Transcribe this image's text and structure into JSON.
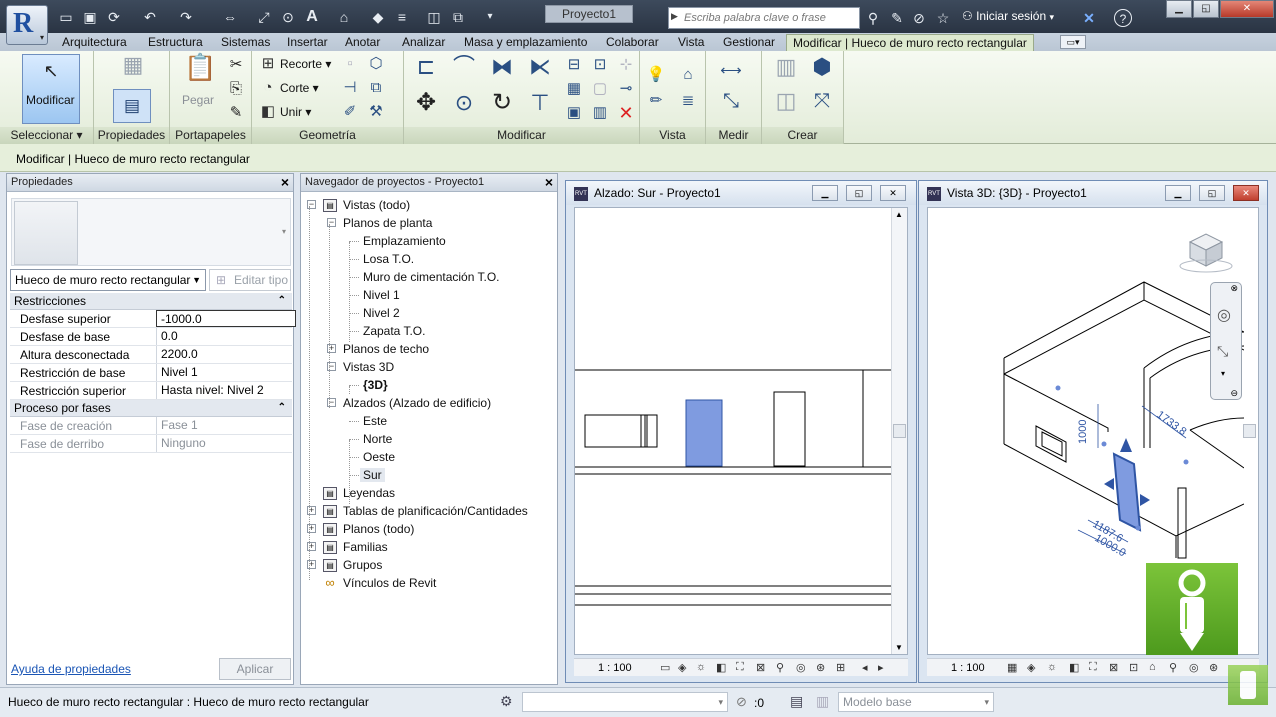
{
  "titlebar": {
    "doc_title": "Proyecto1",
    "search_placeholder": "Escriba palabra clave o frase",
    "signin_label": "Iniciar sesión",
    "help_label": "?",
    "text_tool": "A"
  },
  "tabs": [
    "Arquitectura",
    "Estructura",
    "Sistemas",
    "Insertar",
    "Anotar",
    "Analizar",
    "Masa y emplazamiento",
    "Colaborar",
    "Vista",
    "Gestionar",
    "Modificar | Hueco de muro recto rectangular"
  ],
  "ribbon": {
    "modify_label": "Modificar",
    "paste_label": "Pegar",
    "cut_menu": "Recorte",
    "section_menu": "Corte",
    "join_menu": "Unir",
    "panels": {
      "select": "Seleccionar",
      "properties": "Propiedades",
      "clipboard": "Portapapeles",
      "geometry": "Geometría",
      "modify": "Modificar",
      "view": "Vista",
      "measure": "Medir",
      "create": "Crear"
    }
  },
  "context_bar": "Modificar | Hueco de muro recto rectangular",
  "properties": {
    "title": "Propiedades",
    "type_selector": "Hueco de muro recto rectangular",
    "edit_type": "Editar tipo",
    "sections": [
      {
        "name": "Restricciones",
        "rows": [
          {
            "k": "Desfase superior",
            "v": "-1000.0"
          },
          {
            "k": "Desfase de base",
            "v": "0.0"
          },
          {
            "k": "Altura desconectada",
            "v": "2200.0"
          },
          {
            "k": "Restricción de base",
            "v": "Nivel 1"
          },
          {
            "k": "Restricción superior",
            "v": "Hasta nivel: Nivel 2"
          }
        ]
      },
      {
        "name": "Proceso por fases",
        "rows": [
          {
            "k": "Fase de creación",
            "v": "Fase 1"
          },
          {
            "k": "Fase de derribo",
            "v": "Ninguno"
          }
        ]
      }
    ],
    "help_link": "Ayuda de propiedades",
    "apply": "Aplicar"
  },
  "browser": {
    "title": "Navegador de proyectos - Proyecto1",
    "nodes": [
      {
        "label": "Vistas (todo)",
        "level": 0,
        "exp": "−"
      },
      {
        "label": "Planos de planta",
        "level": 1,
        "exp": "−"
      },
      {
        "label": "Emplazamiento",
        "level": 2
      },
      {
        "label": "Losa T.O.",
        "level": 2
      },
      {
        "label": "Muro de cimentación T.O.",
        "level": 2
      },
      {
        "label": "Nivel 1",
        "level": 2
      },
      {
        "label": "Nivel 2",
        "level": 2
      },
      {
        "label": "Zapata T.O.",
        "level": 2
      },
      {
        "label": "Planos de techo",
        "level": 1,
        "exp": "+"
      },
      {
        "label": "Vistas 3D",
        "level": 1,
        "exp": "−"
      },
      {
        "label": "{3D}",
        "level": 2,
        "bold": true
      },
      {
        "label": "Alzados (Alzado de edificio)",
        "level": 1,
        "exp": "−"
      },
      {
        "label": "Este",
        "level": 2
      },
      {
        "label": "Norte",
        "level": 2
      },
      {
        "label": "Oeste",
        "level": 2
      },
      {
        "label": "Sur",
        "level": 2,
        "sel": true
      },
      {
        "label": "Leyendas",
        "level": 0,
        "icon": true
      },
      {
        "label": "Tablas de planificación/Cantidades",
        "level": 0,
        "exp": "+",
        "icon": true
      },
      {
        "label": "Planos (todo)",
        "level": 0,
        "exp": "+",
        "icon": true
      },
      {
        "label": "Familias",
        "level": 0,
        "exp": "+",
        "icon": true
      },
      {
        "label": "Grupos",
        "level": 0,
        "exp": "+",
        "icon": true
      },
      {
        "label": "Vínculos de Revit",
        "level": 0,
        "icon": true
      }
    ]
  },
  "view_elev": {
    "title": "Alzado: Sur - Proyecto1",
    "scale": "1 : 100"
  },
  "view_3d": {
    "title": "Vista 3D: {3D} - Proyecto1",
    "scale": "1 : 100",
    "dims": [
      "1000",
      "1733.8",
      "1187.6",
      "1000.0"
    ]
  },
  "statusbar": {
    "text": "Hueco de muro recto rectangular : Hueco de muro recto rectangular",
    "count": ":0",
    "model": "Modelo base"
  },
  "colors": {
    "accent": "#2f55a4",
    "ribbon_green": "#e3ecd9",
    "selection_blue": "#7f9be0"
  }
}
